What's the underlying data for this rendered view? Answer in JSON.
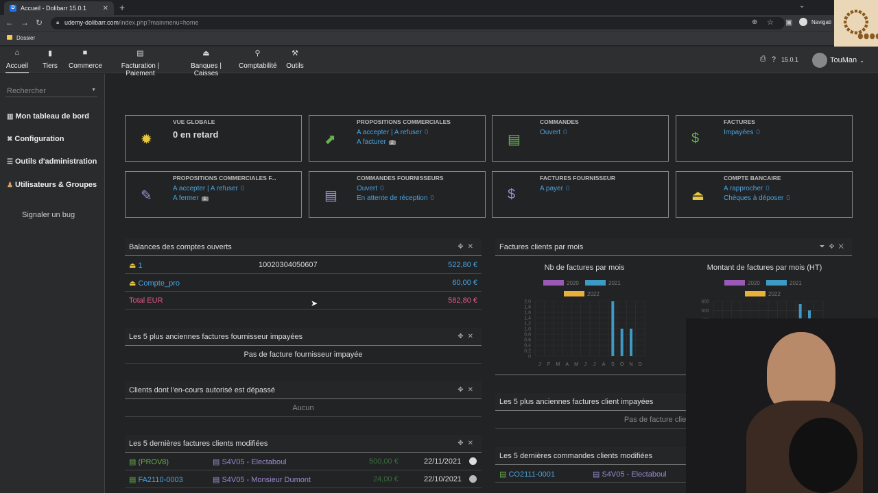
{
  "browser": {
    "tab_title": "Accueil - Dolibarr 15.0.1",
    "tab_favicon": "D",
    "url_host": "udemy-dolibarr.com",
    "url_path": "/index.php?mainmenu=home",
    "bookmark": "Dossier",
    "profile_label": "Navigati"
  },
  "topmenu": {
    "items": [
      {
        "label": "Accueil",
        "icon": "home-icon"
      },
      {
        "label": "Tiers",
        "icon": "building-icon"
      },
      {
        "label": "Commerce",
        "icon": "briefcase-icon"
      },
      {
        "label": "Facturation | Paiement",
        "icon": "money-icon"
      },
      {
        "label": "Banques | Caisses",
        "icon": "bank-icon"
      },
      {
        "label": "Comptabilité",
        "icon": "search-dollar-icon"
      },
      {
        "label": "Outils",
        "icon": "wrench-icon"
      }
    ],
    "version": "15.0.1",
    "user": "TouMan"
  },
  "left": {
    "search_placeholder": "Rechercher",
    "items": [
      {
        "label": "Mon tableau de bord",
        "icon": "chart-icon"
      },
      {
        "label": "Configuration",
        "icon": "tools-icon"
      },
      {
        "label": "Outils d'administration",
        "icon": "server-icon"
      },
      {
        "label": "Utilisateurs & Groupes",
        "icon": "user-icon"
      }
    ],
    "bug": "Signaler un bug"
  },
  "boxes": [
    {
      "title": "Vue globale",
      "big": "0 en retard",
      "icon": "sun-icon"
    },
    {
      "title": "Propositions commerciales",
      "icon": "chart-up-icon",
      "l1": "A accepter | A refuser",
      "l1n": "0",
      "l2": "A facturer",
      "l2n": "2"
    },
    {
      "title": "Commandes",
      "icon": "doc-icon",
      "l1": "Ouvert",
      "l1n": "0"
    },
    {
      "title": "Factures",
      "icon": "invoice-dollar-icon",
      "l1": "Impayées",
      "l1n": "0"
    },
    {
      "title": "Propositions commerciales f...",
      "icon": "signature-icon",
      "l1": "A accepter | A refuser",
      "l1n": "0",
      "l2": "A fermer",
      "l2n": "1"
    },
    {
      "title": "Commandes fournisseurs",
      "icon": "doc-icon",
      "l1": "Ouvert",
      "l1n": "0",
      "l2": "En attente de réception",
      "l2n": "0"
    },
    {
      "title": "Factures fournisseur",
      "icon": "invoice-dollar-icon",
      "l1": "A payer",
      "l1n": "0"
    },
    {
      "title": "Compte bancaire",
      "icon": "bank-icon",
      "l1": "A rapprocher",
      "l1n": "0",
      "l2": "Chèques à déposer",
      "l2n": "0"
    }
  ],
  "balances": {
    "title": "Balances des comptes ouverts",
    "rows": [
      {
        "name": "1",
        "num": "10020304050607",
        "amount": "522,80 €"
      },
      {
        "name": "Compte_pro",
        "num": "",
        "amount": "60,00 €"
      }
    ],
    "total_label": "Total EUR",
    "total": "582,80 €"
  },
  "supplier_unpaid": {
    "title": "Les 5 plus anciennes factures fournisseur impayées",
    "empty": "Pas de facture fournisseur impayée"
  },
  "overcredit": {
    "title": "Clients dont l'en-cours autorisé est dépassé",
    "empty": "Aucun"
  },
  "last_invoices": {
    "title": "Les 5 dernières factures clients modifiées",
    "rows": [
      {
        "ref": "(PROV8)",
        "client": "S4V05 - Electaboul",
        "amount": "500,00 €",
        "date": "22/11/2021"
      },
      {
        "ref": "FA2110-0003",
        "client": "S4V05 - Monsieur Dumont",
        "amount": "24,00 €",
        "date": "22/10/2021"
      }
    ]
  },
  "invoices_month": {
    "title": "Factures clients par mois",
    "chart1_title": "Nb de factures par mois",
    "chart2_title": "Montant de factures par mois (HT)",
    "legend": [
      "2020",
      "2021",
      "2022"
    ]
  },
  "client_unpaid": {
    "title": "Les 5 plus anciennes factures client impayées",
    "empty": "Pas de facture client impayée"
  },
  "last_orders": {
    "title": "Les 5 dernières commandes clients modifiées",
    "rows": [
      {
        "ref": "CO2111-0001",
        "client": "S4V05 - Electaboul"
      }
    ]
  },
  "chart_data": [
    {
      "type": "bar",
      "title": "Nb de factures par mois",
      "categories": [
        "J",
        "F",
        "M",
        "A",
        "M",
        "J",
        "J",
        "A",
        "S",
        "O",
        "N",
        "D"
      ],
      "yticks": [
        "2,0",
        "1,8",
        "1,6",
        "1,4",
        "1,2",
        "1,0",
        "0,8",
        "0,6",
        "0,4",
        "0,2",
        "0"
      ],
      "ylim": [
        0,
        2.0
      ],
      "series": [
        {
          "name": "2020",
          "values": [
            0,
            0,
            0,
            0,
            0,
            0,
            0,
            0,
            0,
            0,
            0,
            0
          ]
        },
        {
          "name": "2021",
          "values": [
            0,
            0,
            0,
            0,
            0,
            0,
            0,
            0,
            2,
            1,
            1,
            0
          ]
        },
        {
          "name": "2022",
          "values": [
            0,
            0,
            0,
            0,
            0,
            0,
            0,
            0,
            0,
            0,
            0,
            0
          ]
        }
      ],
      "colors": {
        "2020": "#9b59b6",
        "2021": "#3d9ac4",
        "2022": "#e8b13a"
      }
    },
    {
      "type": "bar",
      "title": "Montant de factures par mois (HT)",
      "categories": [
        "J",
        "F",
        "M",
        "A",
        "M",
        "J",
        "J",
        "A",
        "S",
        "O",
        "N",
        "D"
      ],
      "yticks": [
        "600",
        "500",
        "400",
        "300",
        "200",
        "100",
        "0"
      ],
      "ylim": [
        0,
        600
      ],
      "series": [
        {
          "name": "2020",
          "values": [
            0,
            0,
            0,
            0,
            0,
            0,
            0,
            0,
            0,
            0,
            0,
            0
          ]
        },
        {
          "name": "2021",
          "values": [
            0,
            0,
            0,
            0,
            0,
            0,
            0,
            0,
            0,
            570,
            500,
            0
          ]
        },
        {
          "name": "2022",
          "values": [
            0,
            0,
            0,
            0,
            0,
            0,
            0,
            0,
            0,
            0,
            0,
            0
          ]
        }
      ],
      "colors": {
        "2020": "#9b59b6",
        "2021": "#3d9ac4",
        "2022": "#e8b13a"
      }
    }
  ]
}
